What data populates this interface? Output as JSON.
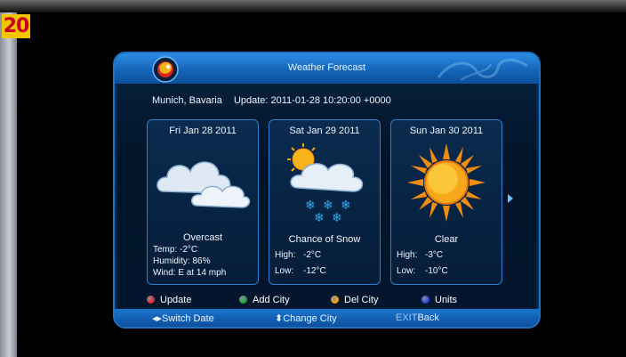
{
  "badge": "20",
  "header": {
    "title": "Weather Forecast"
  },
  "location": {
    "city": "Munich, Bavaria",
    "update": "Update: 2011-01-28 10:20:00 +0000"
  },
  "days": [
    {
      "date": "Fri Jan 28 2011",
      "icon": "cloudy-icon",
      "condition": "Overcast",
      "lines": [
        "Temp:   -2°C",
        "Humidity: 86%",
        "Wind: E at 14 mph"
      ]
    },
    {
      "date": "Sat Jan 29 2011",
      "icon": "snow-icon",
      "condition": "Chance of Snow",
      "high_label": "High:",
      "high": "-2°C",
      "low_label": "Low:",
      "low": "-12°C"
    },
    {
      "date": "Sun Jan 30 2011",
      "icon": "sun-icon",
      "condition": "Clear",
      "high_label": "High:",
      "high": "-3°C",
      "low_label": "Low:",
      "low": "-10°C"
    }
  ],
  "legend": [
    {
      "label": "Update",
      "color": "#e0242c"
    },
    {
      "label": "Add City",
      "color": "#1ea53a"
    },
    {
      "label": "Del City",
      "color": "#f0a010"
    },
    {
      "label": "Units",
      "color": "#2c44d8"
    }
  ],
  "footer": {
    "switch_date": "Switch Date",
    "change_city": "Change City",
    "exit_key": "EXIT",
    "exit_label": "Back"
  }
}
